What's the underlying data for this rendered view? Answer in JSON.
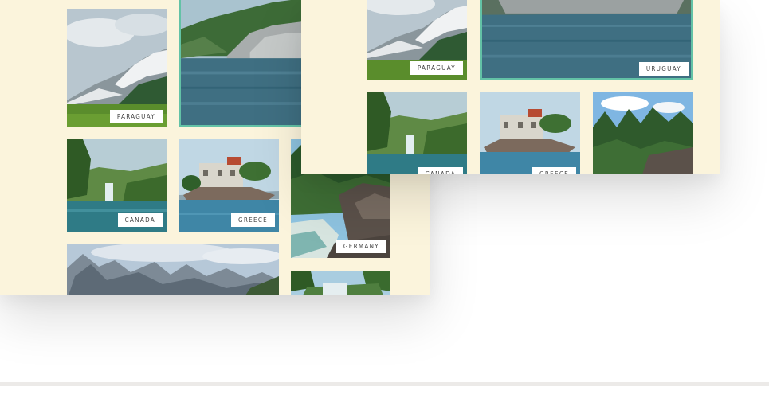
{
  "back_gallery": {
    "paraguay": "PARAGUAY",
    "canada": "CANADA",
    "greece": "GREECE",
    "germany": "GERMANY"
  },
  "front_gallery": {
    "paraguay": "PARAGUAY",
    "uruguay": "URUGUAY",
    "canada": "CANADA",
    "greece": "GREECE"
  },
  "colors": {
    "panel_background": "#fbf4dc",
    "selection_border": "#63c2a6",
    "tag_background": "#ffffff"
  }
}
